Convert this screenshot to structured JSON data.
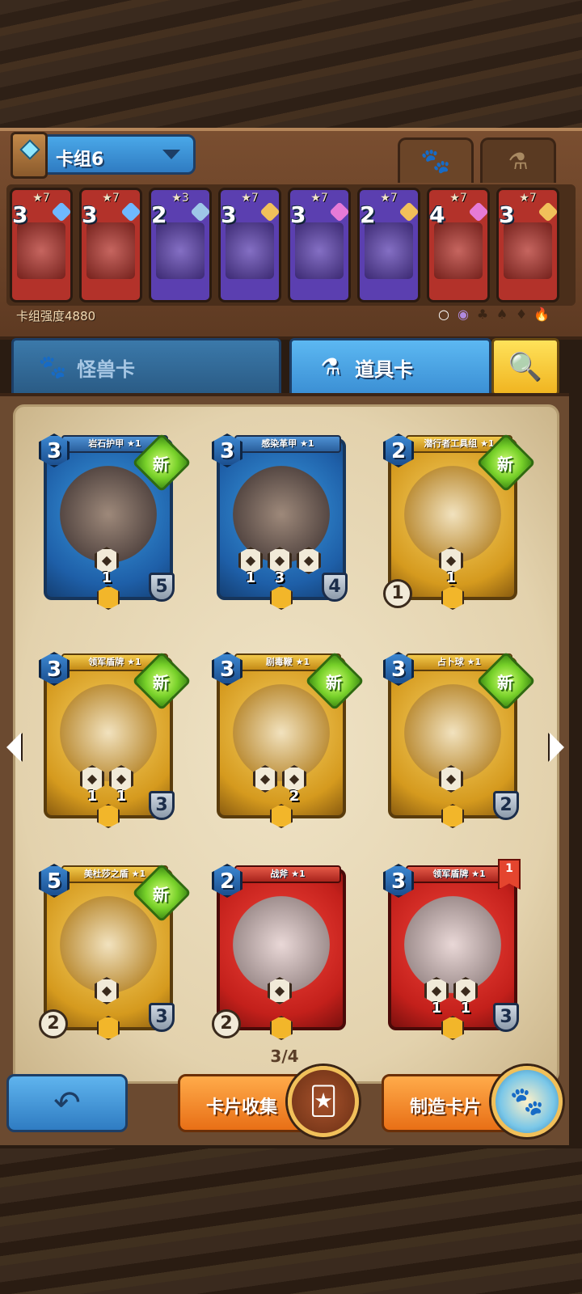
{
  "deck": {
    "name": "卡组6",
    "strength_label": "卡组强度4880",
    "tabs": [
      {
        "icon": "paw-icon",
        "glyph": "🐾",
        "active": true
      },
      {
        "icon": "potion-icon",
        "glyph": "⚗",
        "active": false
      }
    ],
    "cards": [
      {
        "stars": "★7",
        "cost": "3",
        "color": "#b3322a",
        "rarity_color": "#6fb8ff"
      },
      {
        "stars": "★7",
        "cost": "3",
        "color": "#b3322a",
        "rarity_color": "#6fb8ff"
      },
      {
        "stars": "★3",
        "cost": "2",
        "color": "#5b3fb0",
        "rarity_color": "#9ec7e8"
      },
      {
        "stars": "★7",
        "cost": "3",
        "color": "#5b3fb0",
        "rarity_color": "#f1c05a"
      },
      {
        "stars": "★7",
        "cost": "3",
        "color": "#5b3fb0",
        "rarity_color": "#e67ad7"
      },
      {
        "stars": "★7",
        "cost": "2",
        "color": "#5b3fb0",
        "rarity_color": "#f1c05a"
      },
      {
        "stars": "★7",
        "cost": "4",
        "color": "#b3322a",
        "rarity_color": "#e67ad7"
      },
      {
        "stars": "★7",
        "cost": "3",
        "color": "#b3322a",
        "rarity_color": "#f1c05a"
      }
    ],
    "status_icons": [
      "○",
      "◉",
      "♣",
      "♠",
      "♦",
      "🔥"
    ]
  },
  "categories": {
    "monster_label": "怪兽卡",
    "item_label": "道具卡",
    "search_glyph": "🔍"
  },
  "cards": [
    {
      "name": "岩石护甲 ★1",
      "cost": "3",
      "theme": "blue",
      "new": true,
      "new_label": "新",
      "abilities": [
        "1"
      ],
      "level": "5",
      "left_stat": "",
      "flag": ""
    },
    {
      "name": "感染革甲 ★1",
      "cost": "3",
      "theme": "blue",
      "new": false,
      "new_label": "",
      "abilities": [
        "1",
        "3",
        ""
      ],
      "level": "4",
      "left_stat": "",
      "flag": ""
    },
    {
      "name": "潜行者工具组 ★1",
      "cost": "2",
      "theme": "gold",
      "new": true,
      "new_label": "新",
      "abilities": [
        "1"
      ],
      "level": "",
      "left_stat": "1",
      "flag": ""
    },
    {
      "name": "领军盾牌 ★1",
      "cost": "3",
      "theme": "gold",
      "new": true,
      "new_label": "新",
      "abilities": [
        "1",
        "1"
      ],
      "level": "3",
      "left_stat": "",
      "flag": ""
    },
    {
      "name": "剧毒鞭 ★1",
      "cost": "3",
      "theme": "gold",
      "new": true,
      "new_label": "新",
      "abilities": [
        "",
        "2"
      ],
      "level": "",
      "left_stat": "",
      "flag": ""
    },
    {
      "name": "占卜球 ★1",
      "cost": "3",
      "theme": "gold",
      "new": true,
      "new_label": "新",
      "abilities": [
        ""
      ],
      "level": "2",
      "left_stat": "",
      "flag": ""
    },
    {
      "name": "美杜莎之盾 ★1",
      "cost": "5",
      "theme": "gold",
      "new": true,
      "new_label": "新",
      "abilities": [
        ""
      ],
      "level": "3",
      "left_stat": "2",
      "flag": ""
    },
    {
      "name": "战斧 ★1",
      "cost": "2",
      "theme": "red",
      "new": false,
      "new_label": "",
      "abilities": [
        ""
      ],
      "level": "",
      "left_stat": "2",
      "flag": ""
    },
    {
      "name": "领军盾牌 ★1",
      "cost": "3",
      "theme": "red",
      "new": false,
      "new_label": "",
      "abilities": [
        "1",
        "1"
      ],
      "level": "3",
      "left_stat": "",
      "flag": "1"
    }
  ],
  "pagination": {
    "label": "3/4"
  },
  "footer": {
    "back_glyph": "↶",
    "collect_label": "卡片收集",
    "craft_label": "制造卡片"
  }
}
